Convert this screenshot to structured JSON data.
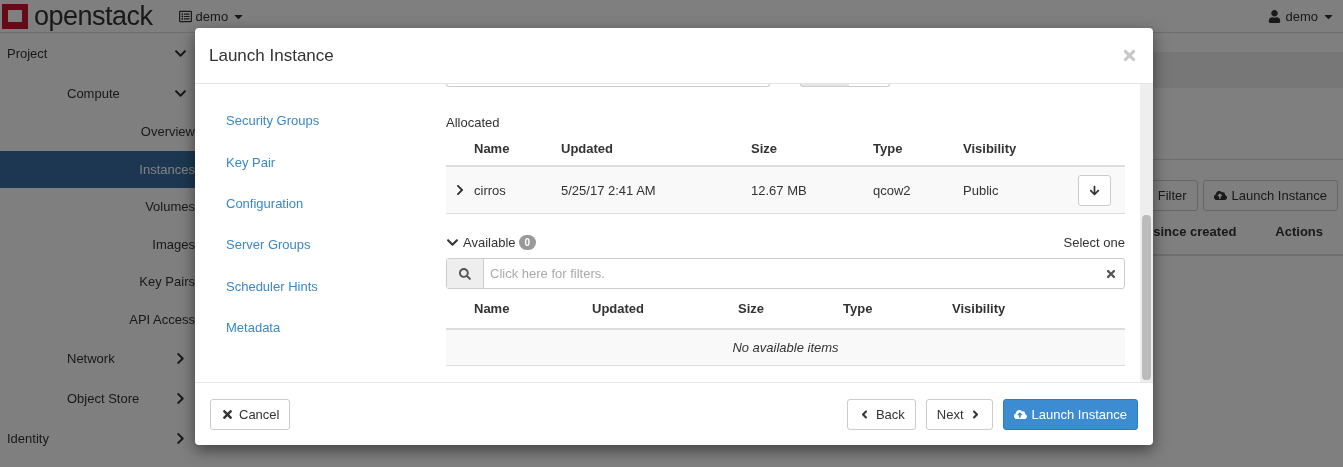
{
  "page": {
    "brand": "openstack",
    "project_menu": "demo",
    "user_menu": "demo",
    "sidebar": [
      {
        "label": "Project",
        "expanded": true,
        "children": [
          {
            "label": "Compute",
            "expanded": true,
            "children": [
              {
                "label": "Overview",
                "selected": false
              },
              {
                "label": "Instances",
                "selected": true
              },
              {
                "label": "Volumes",
                "selected": false
              },
              {
                "label": "Images",
                "selected": false
              },
              {
                "label": "Key Pairs",
                "selected": false
              },
              {
                "label": "API Access",
                "selected": false
              }
            ]
          },
          {
            "label": "Network",
            "expanded": false
          },
          {
            "label": "Object Store",
            "expanded": false
          }
        ]
      },
      {
        "label": "Identity",
        "expanded": false
      }
    ],
    "actions": [
      {
        "kind": "filter",
        "label": "Filter"
      },
      {
        "kind": "launch",
        "label": "Launch Instance"
      }
    ],
    "table_columns": [
      "since created",
      "Actions"
    ]
  },
  "modal": {
    "title": "Launch Instance",
    "steps": [
      "Security Groups",
      "Key Pair",
      "Configuration",
      "Server Groups",
      "Scheduler Hints",
      "Metadata"
    ],
    "allocated": {
      "label": "Allocated",
      "columns": [
        "Name",
        "Updated",
        "Size",
        "Type",
        "Visibility"
      ],
      "rows": [
        {
          "expanded": false,
          "name": "cirros",
          "updated": "5/25/17 2:41 AM",
          "size": "12.67 MB",
          "type": "qcow2",
          "visibility": "Public"
        }
      ]
    },
    "available": {
      "label": "Available",
      "expanded": true,
      "count": "0",
      "hint": "Select one",
      "search": {
        "placeholder": "Click here for filters."
      },
      "columns": [
        "Name",
        "Updated",
        "Size",
        "Type",
        "Visibility"
      ],
      "empty_text": "No available items"
    },
    "buttons": [
      {
        "kind": "cancel",
        "label": "Cancel"
      },
      {
        "kind": "back",
        "label": "Back"
      },
      {
        "kind": "next",
        "label": "Next"
      },
      {
        "kind": "launch",
        "label": "Launch Instance"
      }
    ]
  }
}
